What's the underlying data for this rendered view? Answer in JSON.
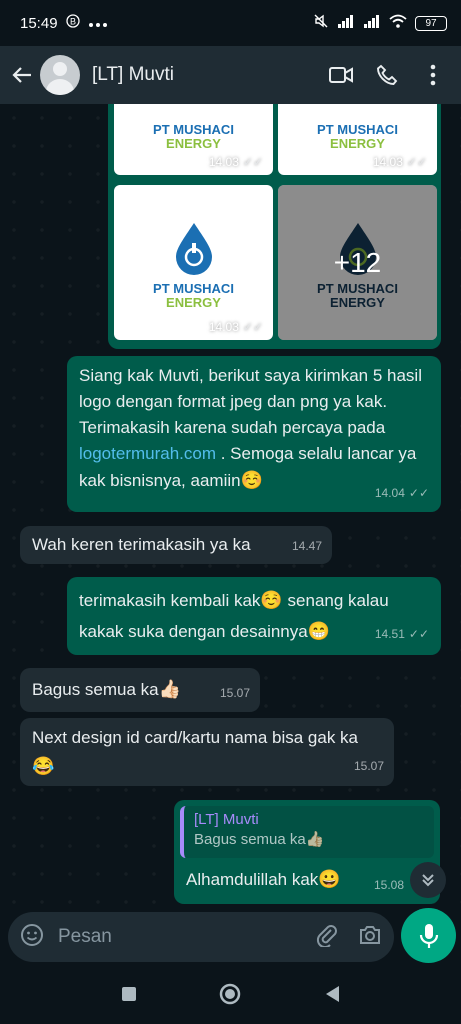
{
  "status_bar": {
    "time": "15:49",
    "battery": "97"
  },
  "header": {
    "chat_name": "[LT] Muvti"
  },
  "media": {
    "brand_line1": "PT MUSHACI",
    "brand_line2": "ENERGY",
    "thumb_time_top_left": "14.03",
    "thumb_time_top_right": "14.03",
    "thumb_time_bottom_left": "14.03",
    "more_count": "+12"
  },
  "messages": [
    {
      "direction": "out",
      "text_before_link": "Siang kak Muvti, berikut saya kirimkan 5 hasil logo dengan format jpeg dan png ya kak. Terimakasih karena sudah percaya pada ",
      "link": "logotermurah.com",
      "text_after_link": " . Semoga selalu lancar ya kak bisnisnya, aamiin",
      "emoji": "☺️",
      "time": "14.04",
      "ticks": "✓✓"
    },
    {
      "direction": "in",
      "text": "Wah keren terimakasih ya ka",
      "time": "14.47"
    },
    {
      "direction": "out",
      "text_part1": "terimakasih kembali kak",
      "emoji1": "☺️",
      "text_part2": " senang kalau kakak suka dengan desainnya",
      "emoji2": "😁",
      "time": "14.51",
      "ticks": "✓✓"
    },
    {
      "direction": "in",
      "text": "Bagus semua ka",
      "emoji": "👍🏻",
      "time": "15.07"
    },
    {
      "direction": "in",
      "text": "Next design id card/kartu nama bisa gak ka ",
      "emoji": "😂",
      "time": "15.07"
    },
    {
      "direction": "out",
      "quote_author": "[LT] Muvti",
      "quote_text": "Bagus semua ka",
      "quote_emoji": "👍🏻",
      "text": "Alhamdulillah kak",
      "emoji": "😀",
      "time": "15.08"
    }
  ],
  "composer": {
    "placeholder": "Pesan"
  },
  "colors": {
    "background": "#0b141a",
    "outgoing_bubble": "#005c4b",
    "incoming_bubble": "#202c33",
    "accent": "#00a884",
    "link": "#53bdeb",
    "quote_author": "#a78bfa"
  },
  "icons": [
    "back-arrow-icon",
    "avatar",
    "video-call-icon",
    "phone-call-icon",
    "more-options-icon",
    "emoji-icon",
    "attach-icon",
    "camera-icon",
    "mic-icon",
    "scroll-down-icon",
    "nav-recents-icon",
    "nav-home-icon",
    "nav-back-icon"
  ]
}
